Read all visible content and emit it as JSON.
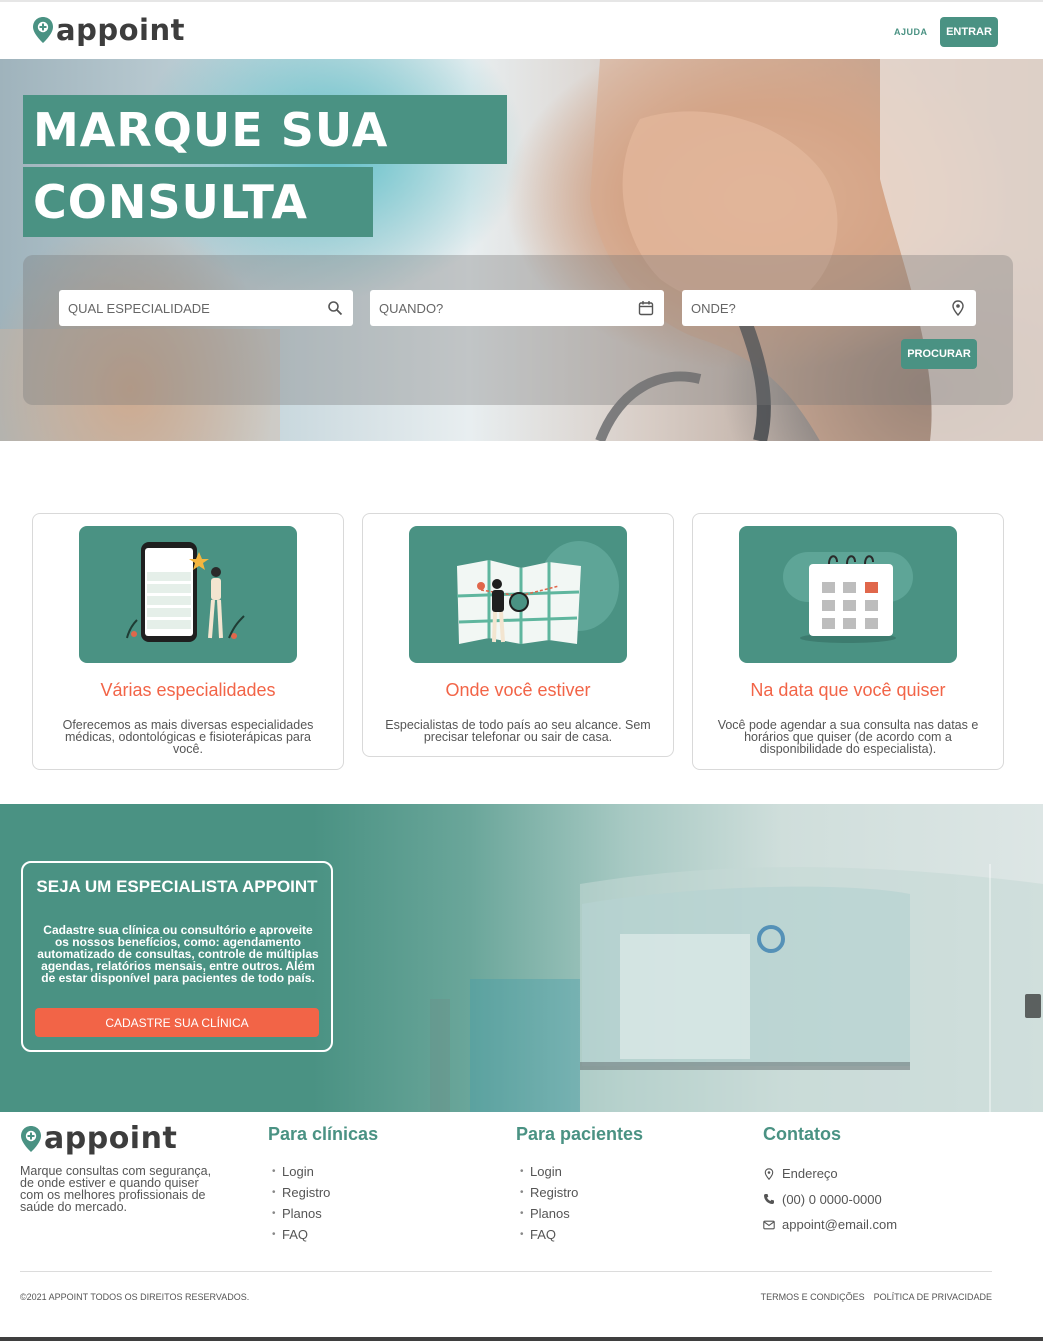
{
  "header": {
    "logo_text": "appoint",
    "help_label": "AJUDA",
    "login_label": "ENTRAR"
  },
  "hero": {
    "title_line1": "MARQUE SUA",
    "title_line2": "CONSULTA",
    "search": {
      "specialty_placeholder": "QUAL ESPECIALIDADE",
      "date_placeholder": "QUANDO?",
      "location_placeholder": "ONDE?",
      "button_label": "PROCURAR"
    }
  },
  "features": [
    {
      "title": "Várias especialidades",
      "text": "Oferecemos as mais diversas especialidades médicas, odontológicas e fisioterápicas para você."
    },
    {
      "title": "Onde você estiver",
      "text": "Especialistas de todo país ao seu alcance. Sem precisar telefonar ou sair de casa."
    },
    {
      "title": "Na data que você quiser",
      "text": "Você pode agendar a sua consulta nas datas e horários que quiser (de acordo com a disponibilidade do especialista)."
    }
  ],
  "specialist": {
    "title": "SEJA UM ESPECIALISTA APPOINT",
    "text": "Cadastre sua clínica ou consultório e aproveite os nossos benefícios, como: agendamento automatizado de consultas, controle de múltiplas agendas, relatórios mensais, entre outros. Além de estar disponível para pacientes de todo país.",
    "button_label": "CADASTRE SUA CLÍNICA"
  },
  "footer": {
    "logo_text": "appoint",
    "description": "Marque consultas com segurança, de onde estiver e quando quiser com os melhores profissionais de saúde do mercado.",
    "clinics": {
      "heading": "Para clínicas",
      "links": [
        "Login",
        "Registro",
        "Planos",
        "FAQ"
      ]
    },
    "patients": {
      "heading": "Para pacientes",
      "links": [
        "Login",
        "Registro",
        "Planos",
        "FAQ"
      ]
    },
    "contacts": {
      "heading": "Contatos",
      "address": "Endereço",
      "phone": "(00) 0 0000-0000",
      "email": "appoint@email.com"
    },
    "copyright": "©2021 APPOINT TODOS OS DIREITOS RESERVADOS.",
    "terms_label": "TERMOS E CONDIÇÕES",
    "privacy_label": "POLÍTICA DE PRIVACIDADE"
  },
  "colors": {
    "brand_green": "#4a9283",
    "accent_orange": "#f26447"
  },
  "icons": {
    "logo": "location-pin-plus-icon",
    "specialty_field": "search-icon",
    "date_field": "calendar-icon",
    "location_field": "map-pin-icon",
    "address": "map-pin-icon",
    "phone": "phone-icon",
    "email": "mail-icon"
  }
}
